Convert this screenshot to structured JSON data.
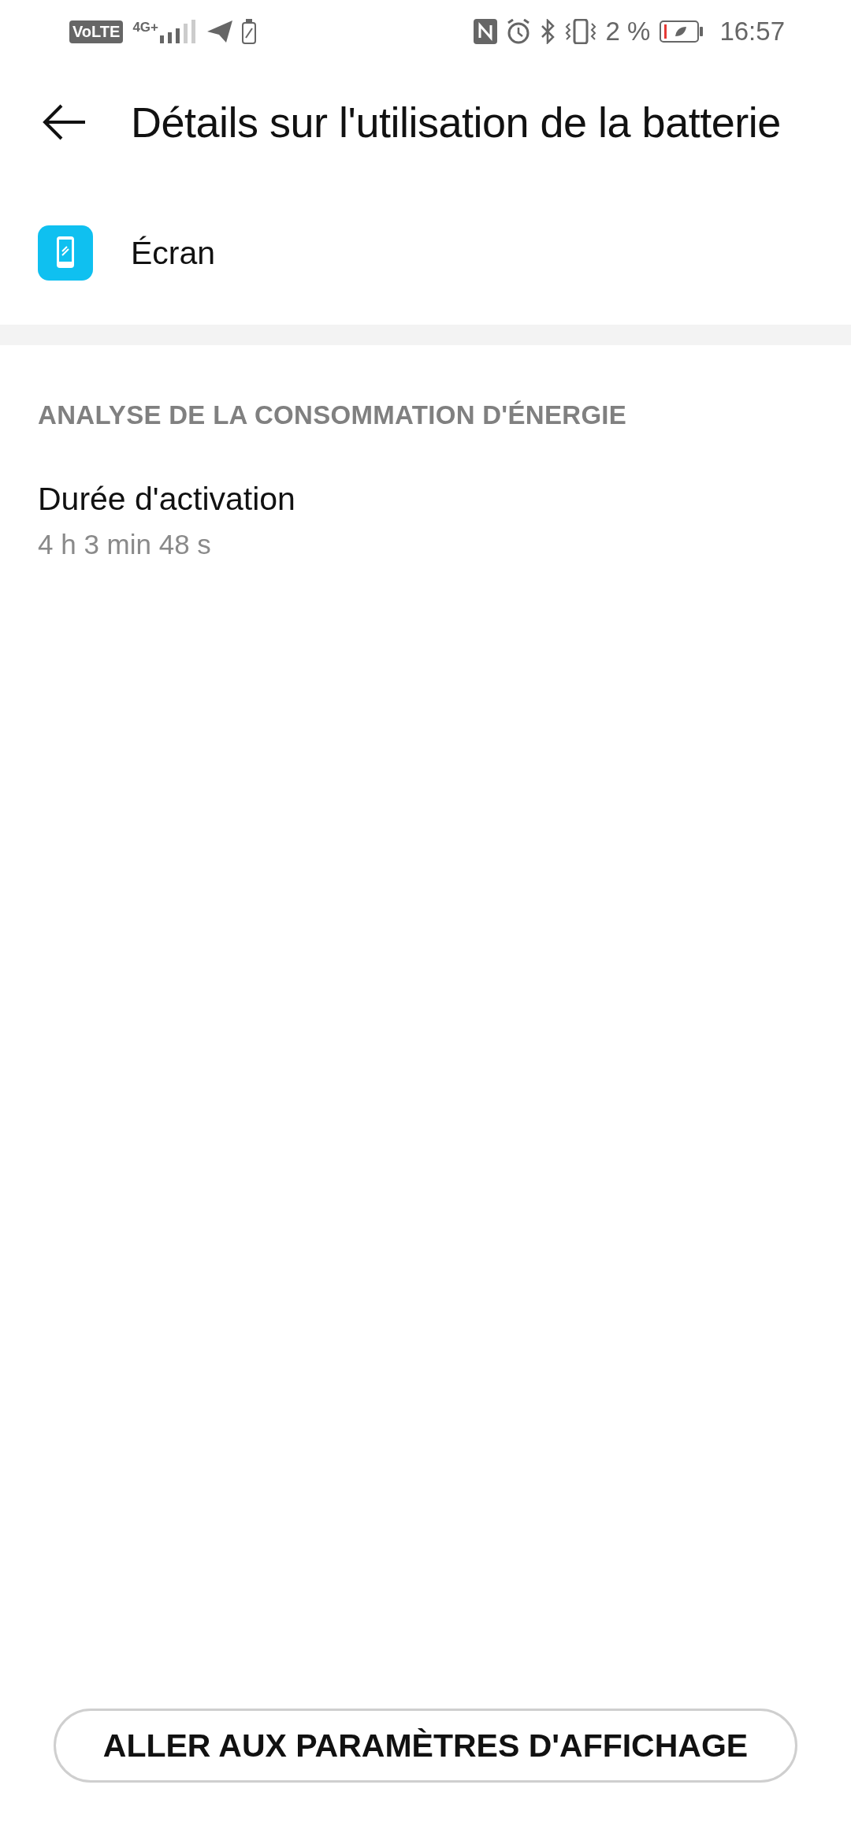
{
  "status_bar": {
    "network_badge": "VoLTE",
    "network_type": "4G+",
    "battery_percent": "2 %",
    "time": "16:57"
  },
  "header": {
    "title": "Détails sur l'utilisation de la batterie"
  },
  "app": {
    "name": "Écran"
  },
  "section": {
    "title": "ANALYSE DE LA CONSOMMATION D'ÉNERGIE",
    "items": [
      {
        "label": "Durée d'activation",
        "value": "4 h 3 min 48 s"
      }
    ]
  },
  "button": {
    "label": "ALLER AUX PARAMÈTRES D'AFFICHAGE"
  }
}
